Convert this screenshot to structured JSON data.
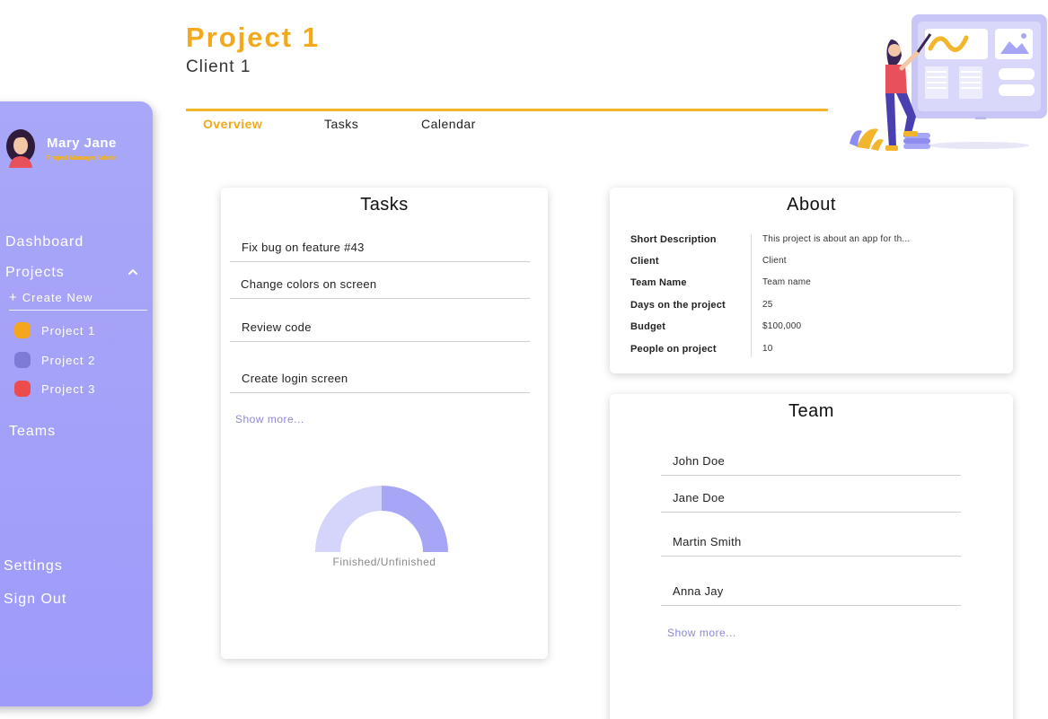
{
  "user": {
    "name": "Mary Jane",
    "role": "Project Manager/Admin"
  },
  "nav": {
    "dashboard": "Dashboard",
    "projects": "Projects",
    "create_new": "Create New",
    "projects_list": [
      {
        "label": "Project 1",
        "color": "#f3a61e"
      },
      {
        "label": "Project 2",
        "color": "#7d7bd6"
      },
      {
        "label": "Project 3",
        "color": "#ec4c4c"
      }
    ],
    "teams": "Teams",
    "settings": "Settings",
    "sign_out": "Sign Out"
  },
  "header": {
    "title": "Project 1",
    "client": "Client 1",
    "tabs": [
      "Overview",
      "Tasks",
      "Calendar"
    ],
    "active_tab": "Overview"
  },
  "tasks_card": {
    "title": "Tasks",
    "items": [
      "Fix bug on feature #43",
      "Change colors on screen",
      "Review code",
      "Create login screen"
    ],
    "show_more": "Show more...",
    "chart_label": "Finished/Unfinished"
  },
  "chart_data": {
    "type": "pie",
    "categories": [
      "Finished",
      "Unfinished"
    ],
    "values": [
      50,
      50
    ],
    "colors": [
      "#a7a5f6",
      "#d5d4fb"
    ],
    "title": "Finished/Unfinished"
  },
  "about_card": {
    "title": "About",
    "rows": [
      {
        "label": "Short Description",
        "value": "This project is about an app for th..."
      },
      {
        "label": "Client",
        "value": "Client"
      },
      {
        "label": "Team Name",
        "value": "Team name"
      },
      {
        "label": "Days on the project",
        "value": "25"
      },
      {
        "label": "Budget",
        "value": "$100,000"
      },
      {
        "label": "People on project",
        "value": "10"
      }
    ]
  },
  "team_card": {
    "title": "Team",
    "members": [
      "John Doe",
      "Jane Doe",
      "Martin Smith",
      "Anna Jay"
    ],
    "show_more": "Show more..."
  },
  "colors": {
    "accent": "#f2a91c",
    "sidebar": "#a5a3f8",
    "link": "#8b89d8"
  }
}
